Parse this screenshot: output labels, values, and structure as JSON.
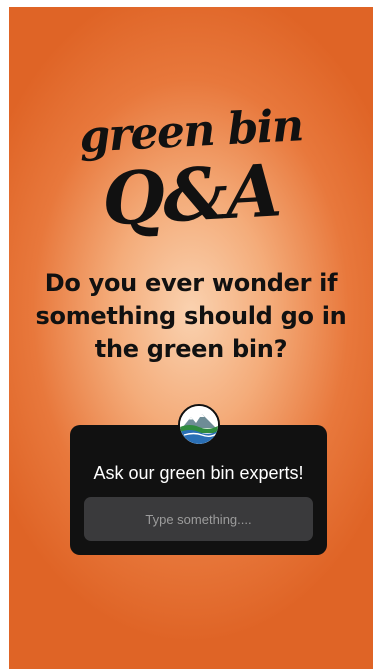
{
  "brand": {
    "line1": "green bin",
    "line2": "Q&A"
  },
  "question": {
    "text": "Do you ever wonder if something should go in the green bin?"
  },
  "question_box": {
    "avatar_icon": "mountain-river-logo-icon",
    "title": "Ask our green bin experts!",
    "input_placeholder": "Type something...."
  },
  "colors": {
    "background_center": "#fad2b0",
    "background_edge": "#df6426",
    "card_bg": "#111111",
    "input_bg": "#3a3a3c",
    "logo_green": "#2e8b3e",
    "logo_blue": "#2a6fb5"
  }
}
